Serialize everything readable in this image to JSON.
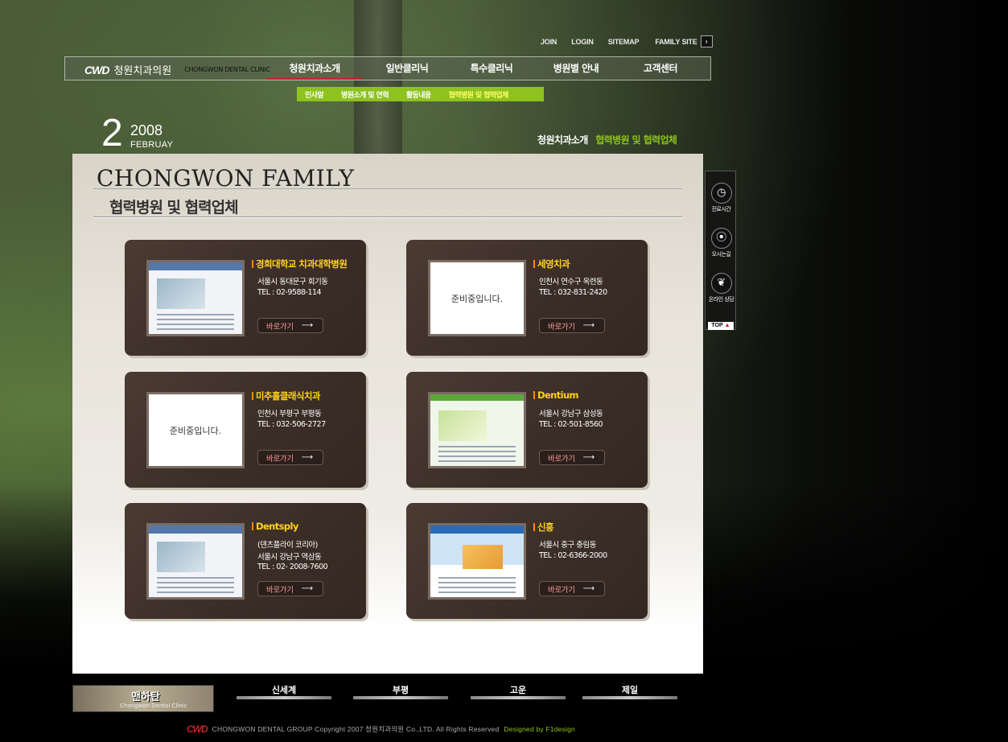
{
  "util": {
    "join": "JOIN",
    "login": "LOGIN",
    "sitemap": "SITEMAP",
    "family": "FAMILY SITE",
    "family_arrow": "›"
  },
  "logo": {
    "mark": "CWD",
    "ko": "청원치과의원",
    "en": "CHONGWON DENTAL CLINIC"
  },
  "nav": [
    "청원치과소개",
    "일반클리닉",
    "특수클리닉",
    "병원별 안내",
    "고객센터"
  ],
  "subnav": [
    "인사말",
    "병원소개 및 연혁",
    "활동내용",
    "협력병원 및 협력업체"
  ],
  "date": {
    "day": "2",
    "year": "2008",
    "month": "FEBRUAY"
  },
  "breadcrumb": {
    "parent": "청원치과소개",
    "current": "협력병원 및 협력업체"
  },
  "panel": {
    "title": "CHONGWON FAMILY",
    "subtitle": "협력병원 및 협력업체"
  },
  "cards": [
    {
      "name": "경희대학교 치과대학병원",
      "lines": [
        "서울시 동대문구 회기동",
        "TEL : 02-9588-114"
      ],
      "thumb": "",
      "btn": "바로가기"
    },
    {
      "name": "세영치과",
      "lines": [
        "인천시 연수구 옥련동",
        "TEL : 032-831-2420"
      ],
      "thumb": "준비중입니다.",
      "btn": "바로가기"
    },
    {
      "name": "미추홀클래식치과",
      "lines": [
        "인천시 부평구 부평동",
        "TEL : 032-506-2727"
      ],
      "thumb": "준비중입니다.",
      "btn": "바로가기"
    },
    {
      "name": "Dentium",
      "lines": [
        "서울시 강남구 삼성동",
        "TEL : 02-501-8560"
      ],
      "thumb": "",
      "btn": "바로가기"
    },
    {
      "name": "Dentsply",
      "lines": [
        "(덴츠플라이 코리아)",
        "서울시 강남구 역삼동",
        "TEL : 02- 2008-7600"
      ],
      "thumb": "",
      "btn": "바로가기"
    },
    {
      "name": "신흥",
      "lines": [
        "서울시 중구 충림동",
        "TEL : 02-6366-2000"
      ],
      "thumb": "",
      "btn": "바로가기"
    }
  ],
  "quick": [
    {
      "icon": "clock-icon",
      "glyph": "◷",
      "label": "진료시간"
    },
    {
      "icon": "traffic-light-icon",
      "glyph": "⦿",
      "label": "오시는길"
    },
    {
      "icon": "leaf-icon",
      "glyph": "❦",
      "label": "온라인 상담"
    }
  ],
  "quick_top": {
    "text": "TOP",
    "arrow": "▲"
  },
  "footer": {
    "banner_title": "맨하탄",
    "banner_sub": "Chongwon Dental Clinic",
    "branches": [
      "신세계",
      "부평",
      "고운",
      "제일"
    ],
    "logo": "CWD",
    "copyright": "CHONGWON DENTAL GROUP Copyright 2007 청원치과의원 Co.,LTD. All Rights Reserved",
    "designer": "Designed by F1design"
  },
  "colors": {
    "accent_green": "#8dc21f",
    "card_brown": "#3a2d26",
    "name_yellow": "#ffd21f",
    "active_red": "#c2242a"
  }
}
